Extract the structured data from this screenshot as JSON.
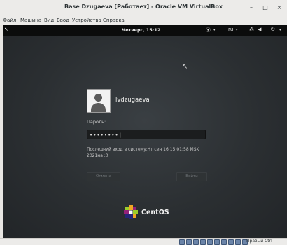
{
  "window": {
    "title": "Base Dzugaeva [Работает] - Oracle VM VirtualBox",
    "minimize": "–",
    "maximize": "□",
    "close": "×"
  },
  "menubar": {
    "items": [
      {
        "label": "Файл"
      },
      {
        "label": "Машина"
      },
      {
        "label": "Вид"
      },
      {
        "label": "Ввод"
      },
      {
        "label": "Устройства"
      },
      {
        "label": "Справка"
      }
    ]
  },
  "topbar": {
    "clock": "Четверг, 15:12",
    "accessibility_icon": "accessibility-icon",
    "language": "ru",
    "network_icon": "network-icon",
    "volume_icon": "volume-icon",
    "power_icon": "power-icon"
  },
  "login": {
    "username": "lvdzugaeva",
    "password_label": "Пароль:",
    "password_value": "••••••••|",
    "last_login": "Последний вход в систему:Чт сен 16 15:01:58 MSK 2021на :0",
    "cancel_label": "Отмена",
    "login_label": "Войти"
  },
  "brand": {
    "name": "CentOS"
  },
  "statusbar": {
    "host_key": "Правый Ctrl"
  },
  "colors": {
    "vm_background": "#2b2f32",
    "topbar": "#0b0c0c",
    "button_bg": "#2f3335",
    "button_text": "#6d7275"
  }
}
